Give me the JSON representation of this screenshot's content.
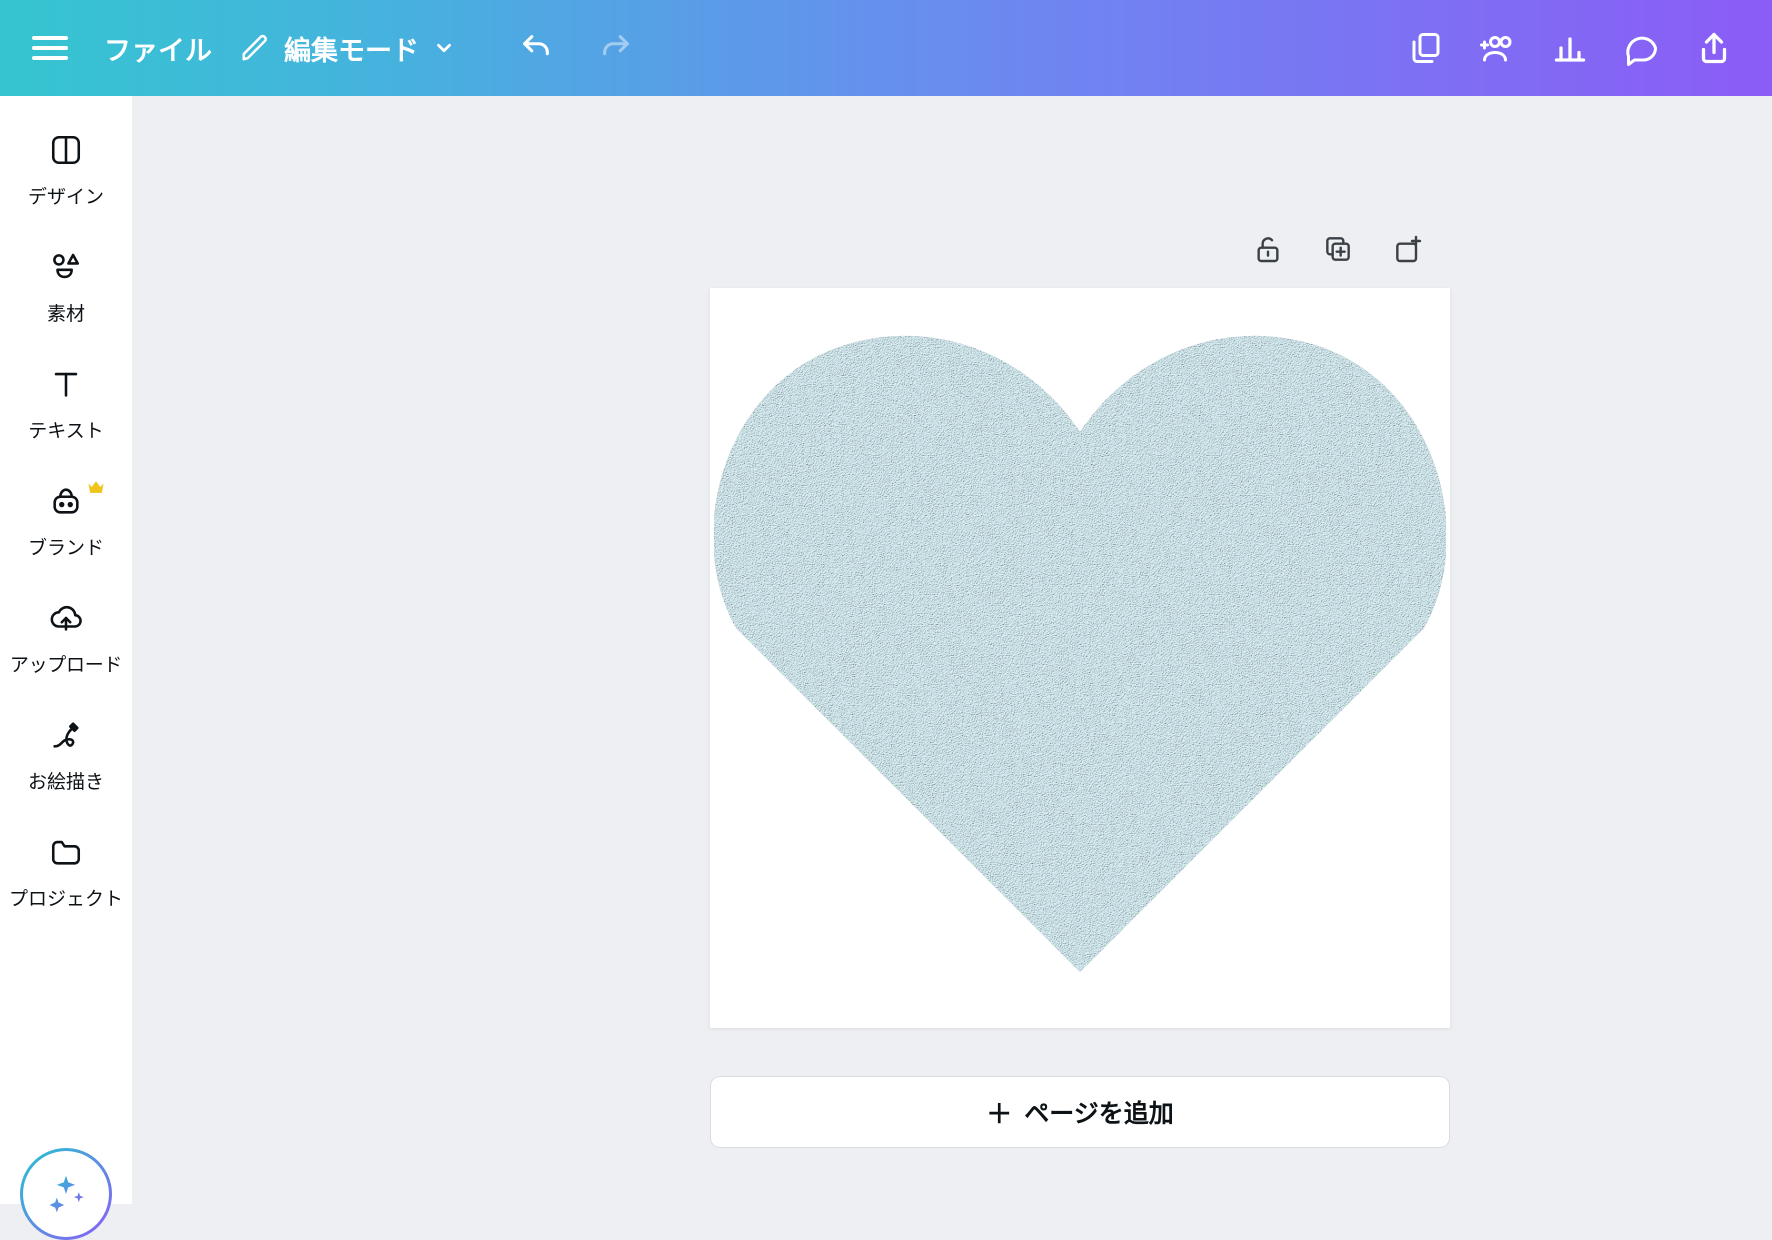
{
  "header": {
    "file_label": "ファイル",
    "edit_mode_label": "編集モード"
  },
  "sidebar": {
    "items": [
      {
        "label": "デザイン"
      },
      {
        "label": "素材"
      },
      {
        "label": "テキスト"
      },
      {
        "label": "ブランド"
      },
      {
        "label": "アップロード"
      },
      {
        "label": "お絵描き"
      },
      {
        "label": "プロジェクト"
      }
    ]
  },
  "canvas": {
    "heart_fill": "#c4d9de",
    "add_page_label": "ページを追加",
    "add_page_prefix": "＋"
  }
}
